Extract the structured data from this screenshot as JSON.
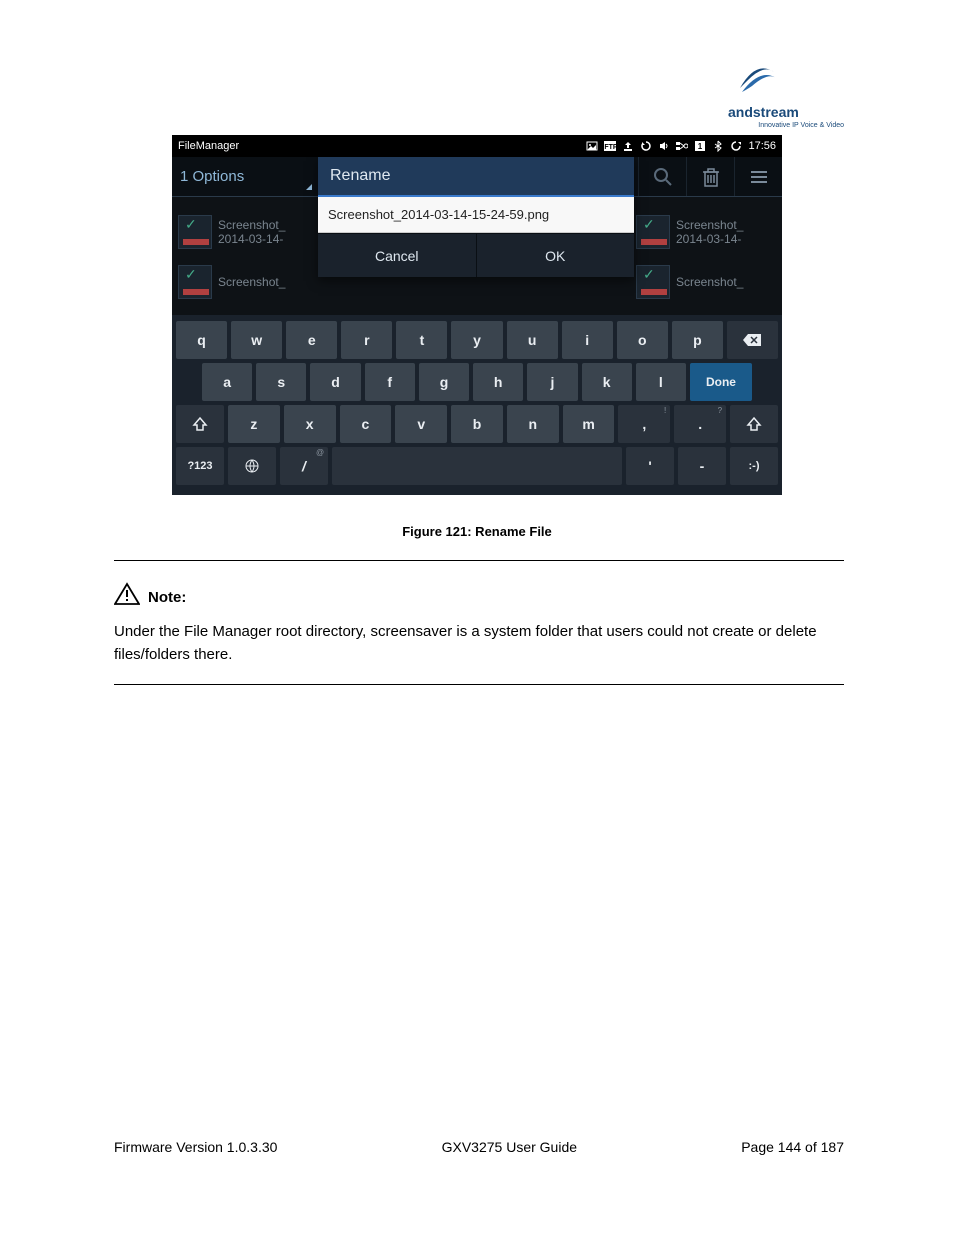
{
  "logo": {
    "brand": "andstream",
    "tagline": "Innovative IP Voice & Video"
  },
  "statusbar": {
    "app_title": "FileManager",
    "time": "17:56"
  },
  "toolbar": {
    "options": "1 Options"
  },
  "files": {
    "tile1_line1": "Screenshot_",
    "tile1_line2": "2014-03-14-",
    "tile2_line1": "Screenshot_",
    "tile2_line2": "2014-03-14-",
    "tile3_line1": "Screenshot_"
  },
  "dialog": {
    "title": "Rename",
    "filename": "Screenshot_2014-03-14-15-24-59.png",
    "cancel": "Cancel",
    "ok": "OK"
  },
  "keyboard": {
    "row1": [
      "q",
      "w",
      "e",
      "r",
      "t",
      "y",
      "u",
      "i",
      "o",
      "p"
    ],
    "row2": [
      "a",
      "s",
      "d",
      "f",
      "g",
      "h",
      "j",
      "k",
      "l"
    ],
    "done": "Done",
    "row3": [
      "z",
      "x",
      "c",
      "v",
      "b",
      "n",
      "m",
      ",",
      "."
    ],
    "sym": "?123",
    "slash": "/",
    "comma_hint": "!",
    "period_hint": "?",
    "slash_hint": "@",
    "apos": "'",
    "dash": "-",
    "smile": ":-)"
  },
  "caption": "Figure 121: Rename File",
  "note": {
    "label": "Note:",
    "body": "Under the File Manager root directory, screensaver is a system folder that users could not create or delete files/folders there."
  },
  "footer": {
    "left": "Firmware Version 1.0.3.30",
    "center": "GXV3275 User Guide",
    "right": "Page 144 of 187"
  }
}
